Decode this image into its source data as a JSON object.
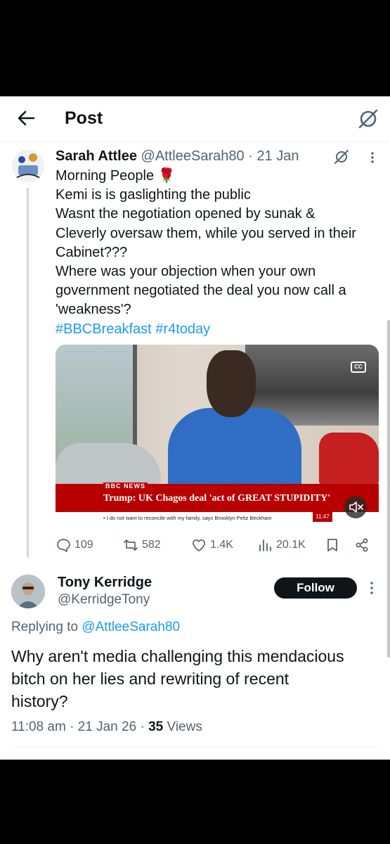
{
  "header": {
    "title": "Post"
  },
  "tweet": {
    "author_name": "Sarah Attlee",
    "handle": "@AttleeSarah80",
    "separator": "·",
    "date": "21 Jan",
    "lines": [
      "Morning People",
      "Kemi is is gaslighting the public",
      "Wasnt the negotiation opened by sunak &",
      "Cleverly oversaw them, while you served in their",
      "Cabinet???",
      "Where was your objection when your own",
      "government negotiated the deal you now call a",
      "'weakness'?"
    ],
    "emoji": "🌹",
    "hashtags": "#BBCBreakfast #r4today",
    "media": {
      "news_logo": "BBC NEWS",
      "headline": "Trump: UK Chagos deal 'act of GREAT STUPIDITY'",
      "ticker": "• I do not want to reconcile with my family, says Brooklyn Peltz Beckham",
      "clock": "11:47"
    },
    "stats": {
      "replies": "109",
      "reposts": "582",
      "likes": "1.4K",
      "views": "20.1K"
    }
  },
  "reply": {
    "author_name": "Tony Kerridge",
    "handle": "@KerridgeTony",
    "follow_label": "Follow",
    "replying_prefix": "Replying to",
    "replying_handle": "@AttleeSarah80",
    "lines": [
      "Why aren't media challenging this mendacious",
      "bitch on her lies and rewriting of recent",
      "history?"
    ],
    "time": "11:08 am",
    "date": "21 Jan 26",
    "views_count": "35",
    "views_label": "Views"
  },
  "colors": {
    "accent": "#1d9bf0",
    "text": "#0f1419",
    "muted": "#536471",
    "bbc_red": "#b80000"
  }
}
